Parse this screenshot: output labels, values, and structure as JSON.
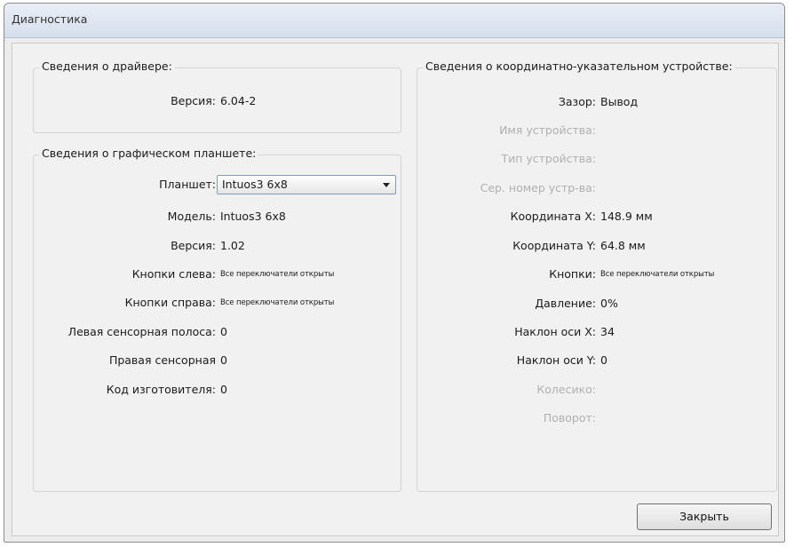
{
  "window": {
    "title": "Диагностика"
  },
  "driver": {
    "heading": "Сведения о драйвере:",
    "version_label": "Версия:",
    "version_value": "6.04-2"
  },
  "tablet": {
    "heading": "Сведения о графическом планшете:",
    "tablet_label": "Планшет:",
    "tablet_selected": "Intuos3 6x8",
    "model_label": "Модель:",
    "model_value": "Intuos3 6x8",
    "version_label": "Версия:",
    "version_value": "1.02",
    "left_buttons_label": "Кнопки слева:",
    "left_buttons_value": "Все переключатели открыты",
    "right_buttons_label": "Кнопки справа:",
    "right_buttons_value": "Все переключатели открыты",
    "left_strip_label": "Левая сенсорная полоса:",
    "left_strip_value": "0",
    "right_strip_label": "Правая сенсорная",
    "right_strip_value": "0",
    "manufacturer_label": "Код изготовителя:",
    "manufacturer_value": "0"
  },
  "pointer": {
    "heading": "Сведения о координатно-указательном устройстве:",
    "gap_label": "Зазор:",
    "gap_value": "Вывод",
    "device_name_label": "Имя устройства:",
    "device_type_label": "Тип устройства:",
    "serial_label": "Сер. номер устр-ва:",
    "coord_x_label": "Координата X:",
    "coord_x_value": "148.9 мм",
    "coord_y_label": "Координата Y:",
    "coord_y_value": "64.8 мм",
    "buttons_label": "Кнопки:",
    "buttons_value": "Все переключатели открыты",
    "pressure_label": "Давление:",
    "pressure_value": "0%",
    "tilt_x_label": "Наклон оси X:",
    "tilt_x_value": "34",
    "tilt_y_label": "Наклон оси Y:",
    "tilt_y_value": "0",
    "wheel_label": "Колесико:",
    "rotation_label": "Поворот:"
  },
  "footer": {
    "close_label": "Закрыть"
  }
}
